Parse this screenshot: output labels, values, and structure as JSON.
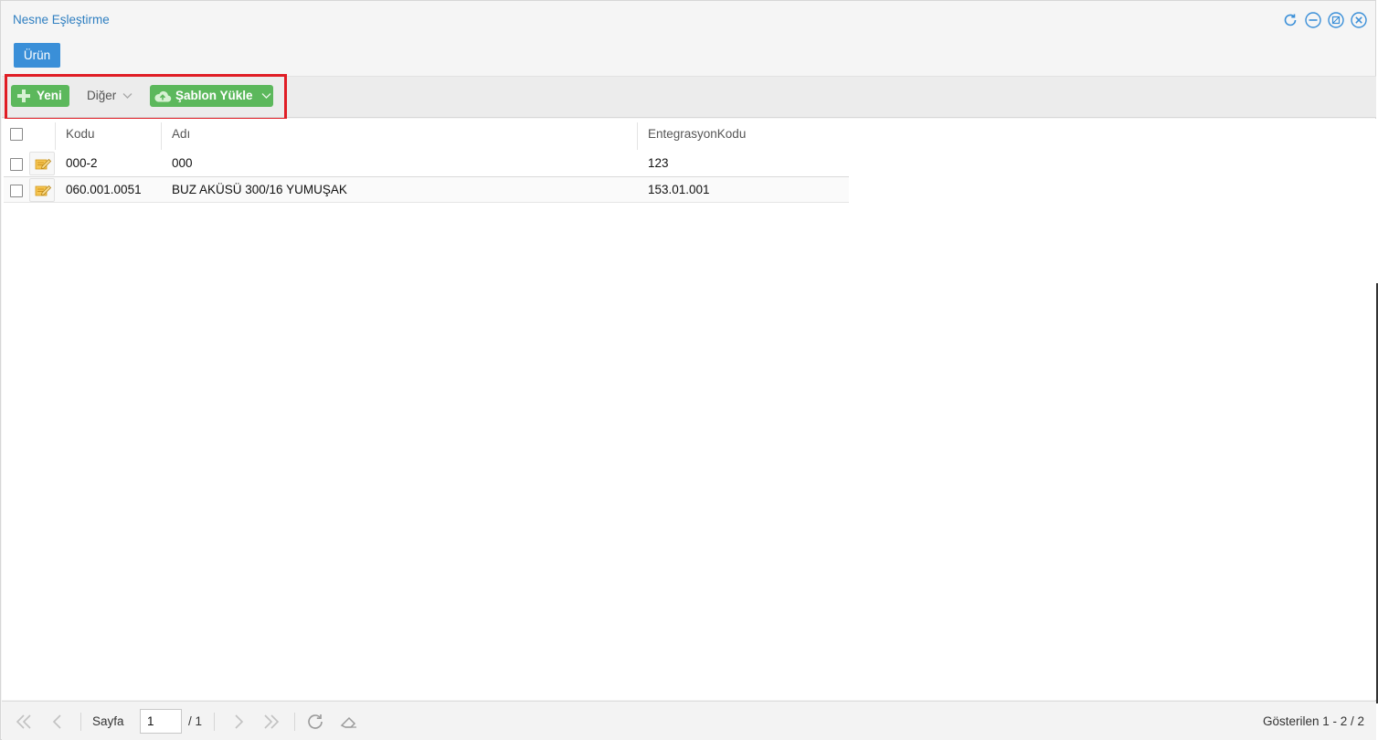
{
  "window": {
    "title": "Nesne Eşleştirme",
    "controls": [
      "refresh-icon",
      "minimize-icon",
      "restore-icon",
      "close-icon"
    ]
  },
  "tabs": {
    "active_label": "Ürün"
  },
  "toolbar": {
    "new_label": "Yeni",
    "other_label": "Diğer",
    "template_label": "Şablon Yükle"
  },
  "grid": {
    "columns": [
      "Kodu",
      "Adı",
      "EntegrasyonKodu"
    ],
    "rows": [
      {
        "kodu": "000-2",
        "adi": "000",
        "entegrasyon_kodu": "123"
      },
      {
        "kodu": "060.001.0051",
        "adi": "BUZ AKÜSÜ 300/16 YUMUŞAK",
        "entegrasyon_kodu": "153.01.001"
      }
    ]
  },
  "pager": {
    "page_label": "Sayfa",
    "current_page": "1",
    "total_pages": "/ 1",
    "summary": "Gösterilen 1 - 2 / 2"
  },
  "colors": {
    "title_blue": "#2f7fc1",
    "tab_blue": "#3a8fd8",
    "button_green": "#5cb85c",
    "highlight_red": "#e01d25"
  }
}
